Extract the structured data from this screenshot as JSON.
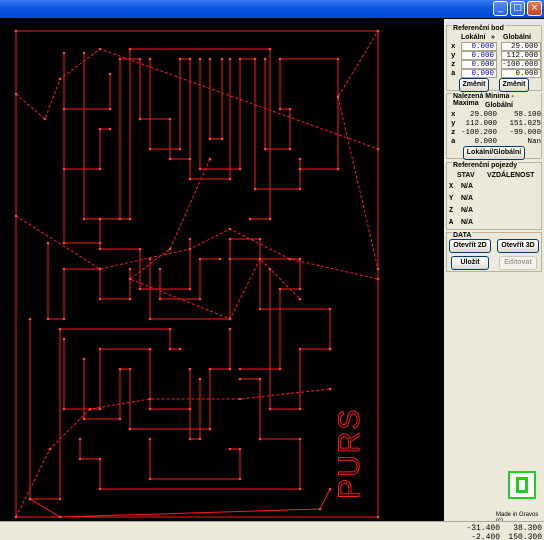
{
  "window": {
    "btn_minimize": "_",
    "btn_maximize": "□",
    "btn_close": "×"
  },
  "reference_point": {
    "title": "Referenční bod",
    "col_local": "Lokální",
    "col_arrow": "»",
    "col_global": "Globální",
    "rows": [
      {
        "axis": "x",
        "local": "0.000",
        "global": "29.000"
      },
      {
        "axis": "y",
        "local": "0.000",
        "global": "112.000"
      },
      {
        "axis": "z",
        "local": "0.000",
        "global": "-100.000"
      },
      {
        "axis": "a",
        "local": "0.000",
        "global": "0.000"
      }
    ],
    "btn_change_local": "Změnit",
    "btn_change_global": "Změnit"
  },
  "minmax": {
    "title": "Nalezená Minima - Maxima",
    "col_label": "Globální",
    "rows": [
      {
        "axis": "x",
        "min": "29.000",
        "max": "58.100"
      },
      {
        "axis": "y",
        "min": "112.000",
        "max": "151.025"
      },
      {
        "axis": "z",
        "min": "-100.200",
        "max": "-99.000"
      },
      {
        "axis": "a",
        "min": "0.000",
        "max": "Nan"
      }
    ],
    "btn_toggle": "Lokální/Globální"
  },
  "ref_travel": {
    "title": "Referenční pojezdy",
    "col_state": "STAV",
    "col_distance": "VZDÁLENOST",
    "rows": [
      {
        "axis": "X",
        "state": "N/A"
      },
      {
        "axis": "Y",
        "state": "N/A"
      },
      {
        "axis": "Z",
        "state": "N/A"
      },
      {
        "axis": "A",
        "state": "N/A"
      }
    ]
  },
  "data": {
    "title": "DATA",
    "btn_open2d": "Otevřít 2D",
    "btn_open3d": "Otevřít 3D",
    "btn_save": "Uložit",
    "btn_edit": "Editovat"
  },
  "made_in": "Made in Gravos (c)",
  "status": {
    "x": "-31.400",
    "y": "38.300",
    "x2": "-2.400",
    "y2": "150.300"
  },
  "colors": {
    "toolpath": "#ff1a1a",
    "background": "#000000",
    "logo": "#22cc22"
  },
  "canvas_label": "PURS",
  "logo_icon": "gravos-logo-icon"
}
